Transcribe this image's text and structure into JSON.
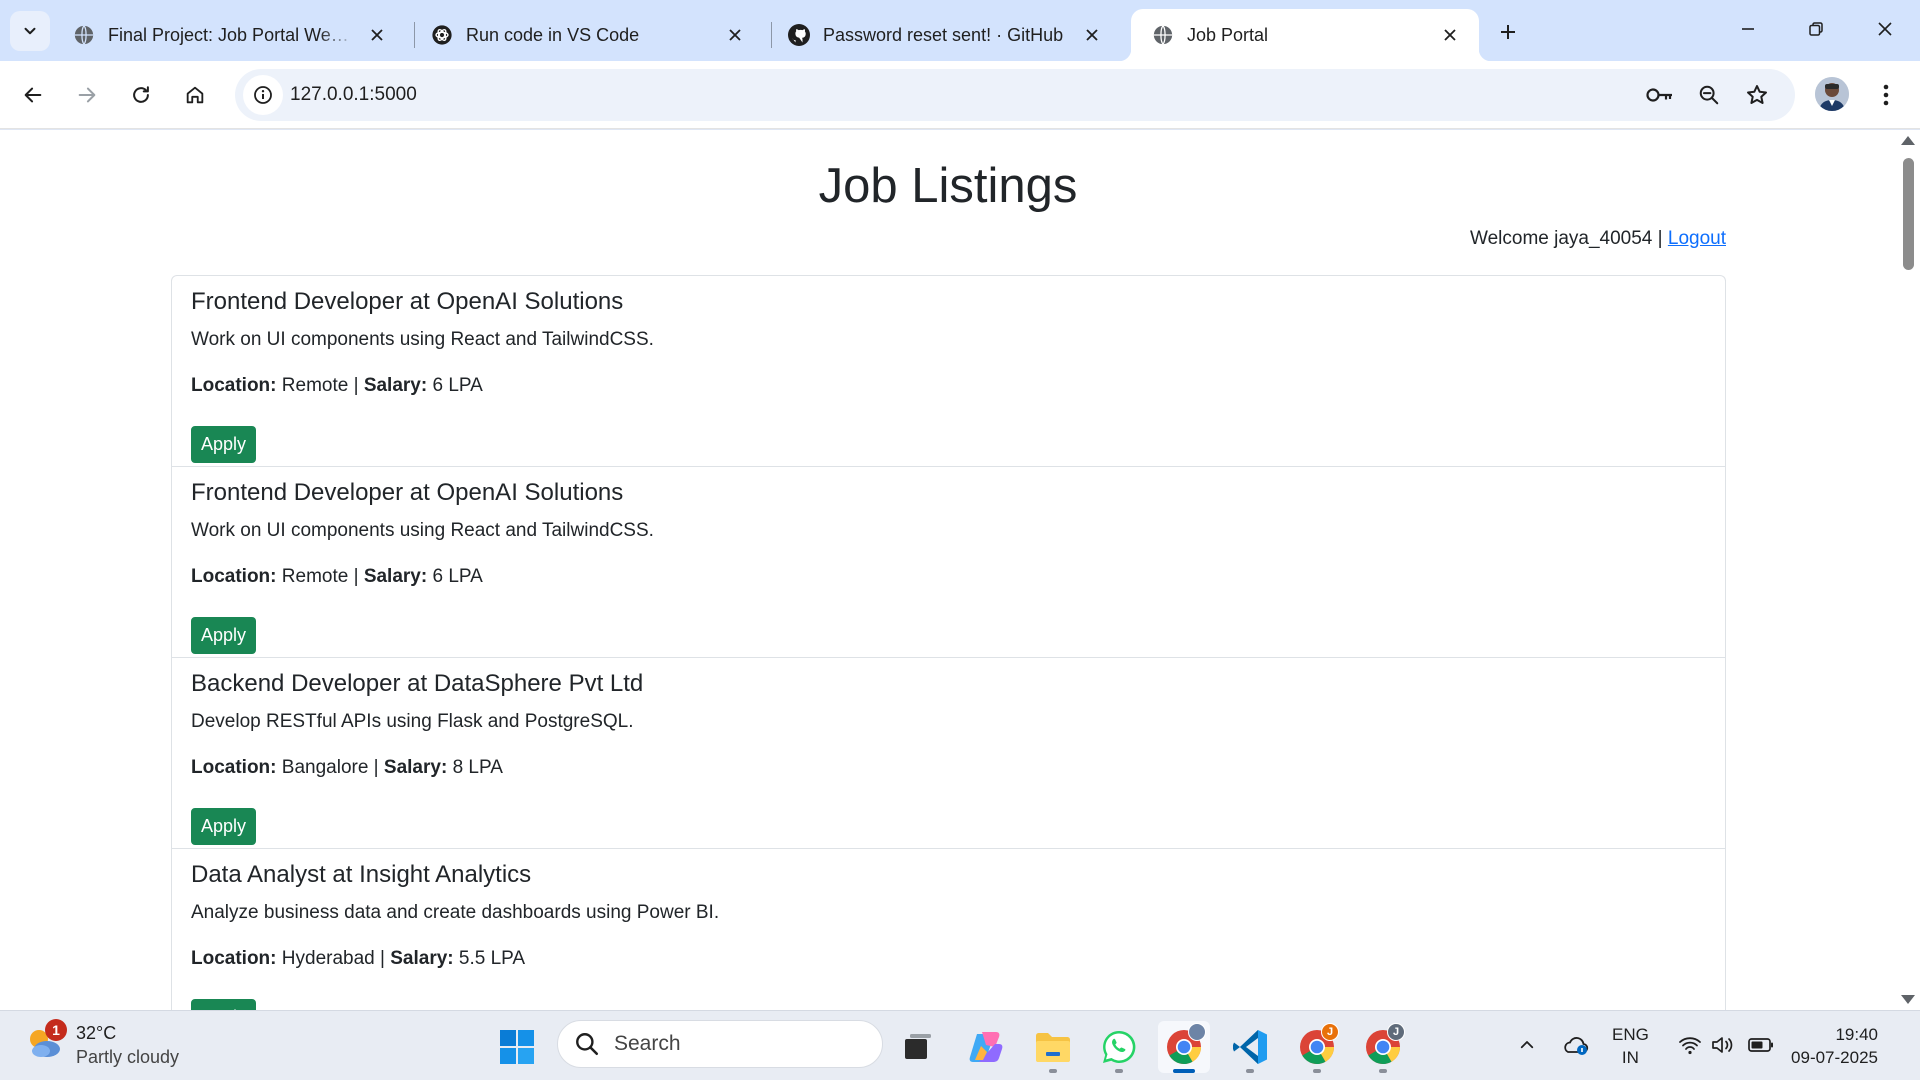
{
  "browser": {
    "tabs": [
      {
        "title": "Final Project: Job Portal Web Ap",
        "icon": "globe-icon",
        "active": false
      },
      {
        "title": "Run code in VS Code",
        "icon": "openai-icon",
        "active": false
      },
      {
        "title": "Password reset sent! · GitHub",
        "icon": "github-icon",
        "active": false
      },
      {
        "title": "Job Portal",
        "icon": "globe-icon",
        "active": true
      }
    ],
    "url": "127.0.0.1:5000"
  },
  "page": {
    "title": "Job Listings",
    "welcome_text": "Welcome jaya_40054 |",
    "logout_label": "Logout",
    "location_label": "Location:",
    "salary_label": "Salary:",
    "apply_label": "Apply",
    "jobs": [
      {
        "title": "Frontend Developer at OpenAI Solutions",
        "description": "Work on UI components using React and TailwindCSS.",
        "location": "Remote",
        "salary": "6 LPA"
      },
      {
        "title": "Frontend Developer at OpenAI Solutions",
        "description": "Work on UI components using React and TailwindCSS.",
        "location": "Remote",
        "salary": "6 LPA"
      },
      {
        "title": "Backend Developer at DataSphere Pvt Ltd",
        "description": "Develop RESTful APIs using Flask and PostgreSQL.",
        "location": "Bangalore",
        "salary": "8 LPA"
      },
      {
        "title": "Data Analyst at Insight Analytics",
        "description": "Analyze business data and create dashboards using Power BI.",
        "location": "Hyderabad",
        "salary": "5.5 LPA"
      }
    ]
  },
  "taskbar": {
    "weather_temp": "32°C",
    "weather_desc": "Partly cloudy",
    "weather_badge": "1",
    "search_label": "Search",
    "lang_line1": "ENG",
    "lang_line2": "IN",
    "time": "19:40",
    "date": "09-07-2025",
    "chrome_badge_1": "J",
    "chrome_badge_2": "J"
  },
  "colors": {
    "accent_green": "#198754",
    "link_blue": "#0d6efd",
    "tabstrip": "#d3e3fd"
  }
}
